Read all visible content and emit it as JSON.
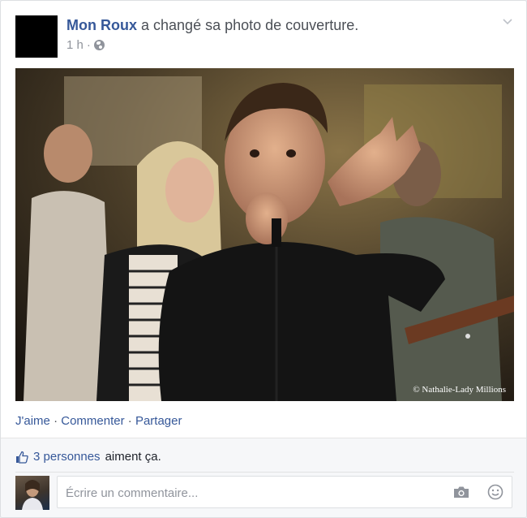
{
  "post": {
    "author": "Mon Roux",
    "action": "a changé sa photo de couverture.",
    "time": "1 h",
    "separator": "·",
    "photo_credit": "© Nathalie-Lady Millions"
  },
  "actions": {
    "like": "J'aime",
    "comment": "Commenter",
    "share": "Partager",
    "separator": "·"
  },
  "likes": {
    "count": "3 personnes",
    "text": "aiment ça."
  },
  "comment": {
    "placeholder": "Écrire un commentaire..."
  },
  "icons": {
    "privacy": "globe-icon",
    "menu": "chevron-down-icon",
    "like": "thumbs-up-icon",
    "camera": "camera-icon",
    "emoji": "smiley-icon"
  },
  "colors": {
    "link": "#365899",
    "text": "#4b4f56",
    "meta": "#90949c",
    "footer_bg": "#f6f7f9"
  }
}
